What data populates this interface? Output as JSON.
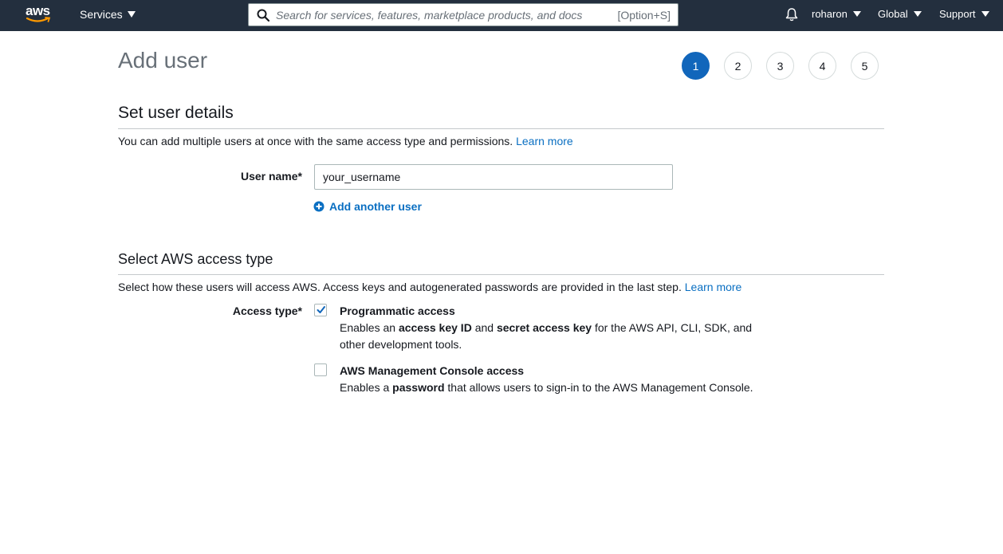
{
  "nav": {
    "logo_text": "aws",
    "services_label": "Services",
    "search_placeholder": "Search for services, features, marketplace products, and docs",
    "search_shortcut": "[Option+S]",
    "notifications_icon": "bell-icon",
    "user_label": "roharon",
    "region_label": "Global",
    "support_label": "Support"
  },
  "page": {
    "title": "Add user",
    "steps": [
      "1",
      "2",
      "3",
      "4",
      "5"
    ],
    "active_step": "1"
  },
  "user_details": {
    "title": "Set user details",
    "description": "You can add multiple users at once with the same access type and permissions.",
    "learn_more": "Learn more",
    "username_label": "User name*",
    "username_value": "your_username",
    "add_another_label": "Add another user"
  },
  "access_type": {
    "title": "Select AWS access type",
    "description": "Select how these users will access AWS. Access keys and autogenerated passwords are provided in the last step.",
    "learn_more": "Learn more",
    "label": "Access type*",
    "options": [
      {
        "title": "Programmatic access",
        "checked": true,
        "desc_1": "Enables an ",
        "desc_b1": "access key ID",
        "desc_2": " and ",
        "desc_b2": "secret access key",
        "desc_3": " for the AWS API, CLI, SDK, and other development tools."
      },
      {
        "title": "AWS Management Console access",
        "checked": false,
        "desc_1": "Enables a ",
        "desc_b1": "password",
        "desc_2": " that allows users to sign-in to the AWS Management Console."
      }
    ]
  },
  "colors": {
    "nav_bg": "#232f3e",
    "accent": "#1166bb",
    "link": "#0a6fc2"
  }
}
